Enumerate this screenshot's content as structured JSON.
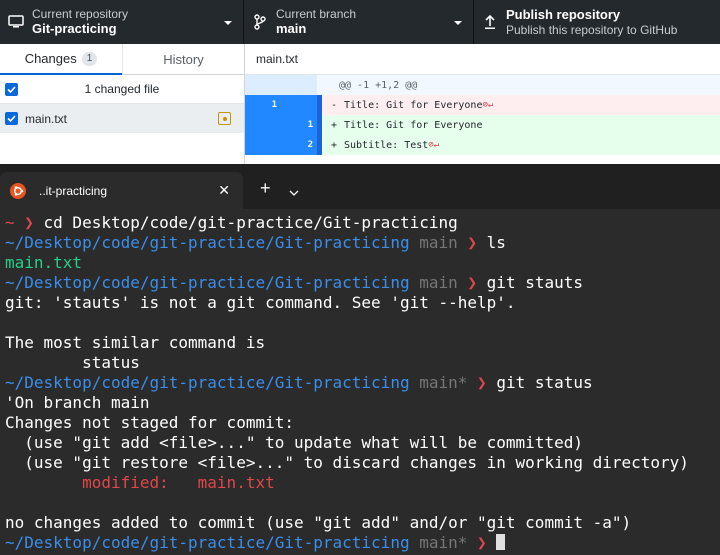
{
  "toolbar": {
    "repo": {
      "sub": "Current repository",
      "main": "Git-practicing"
    },
    "branch": {
      "sub": "Current branch",
      "main": "main"
    },
    "publish": {
      "title": "Publish repository",
      "sub": "Publish this repository to GitHub"
    }
  },
  "sidebar": {
    "tabs": {
      "changes": "Changes",
      "changes_count": "1",
      "history": "History"
    },
    "changed_files": "1 changed file",
    "files": [
      {
        "name": "main.txt",
        "status": "modified"
      }
    ]
  },
  "diff": {
    "file": "main.txt",
    "hunk": "@@ -1 +1,2 @@",
    "lines": [
      {
        "type": "del",
        "old": "1",
        "new": "",
        "sign": "-",
        "text": "Title: Git for Everyone"
      },
      {
        "type": "add",
        "old": "",
        "new": "1",
        "sign": "+",
        "text": "Title: Git for Everyone"
      },
      {
        "type": "add",
        "old": "",
        "new": "2",
        "sign": "+",
        "text": "Subtitle: Test"
      }
    ]
  },
  "terminal": {
    "tab_title": "..it-practicing",
    "lines": {
      "l1_prompt": "~ ❯ ",
      "l1_cmd": "cd Desktop/code/git-practice/Git-practicing",
      "path": "~/Desktop/code/git-practice/Git-practicing",
      "branch": "main",
      "branch_dirty": "main*",
      "arrow": "❯",
      "cmd_ls": "ls",
      "ls_out": "main.txt",
      "cmd_stauts": "git stauts",
      "err": "git: 'stauts' is not a git command. See 'git --help'.",
      "similar": "The most similar command is",
      "suggest": "        status",
      "cmd_status": "git status",
      "on_branch": "'On branch main",
      "not_staged": "Changes not staged for commit:",
      "hint_add": "  (use \"git add <file>...\" to update what will be committed)",
      "hint_restore": "  (use \"git restore <file>...\" to discard changes in working directory)",
      "mod_label": "        modified:   ",
      "mod_file": "main.txt",
      "no_changes": "no changes added to commit (use \"git add\" and/or \"git commit -a\")"
    }
  },
  "colors": {
    "path": "#3b8eea",
    "branch": "#767676",
    "arrow": "#e0474b",
    "ls_file": "#23d18b",
    "accent": "#2188ff"
  }
}
